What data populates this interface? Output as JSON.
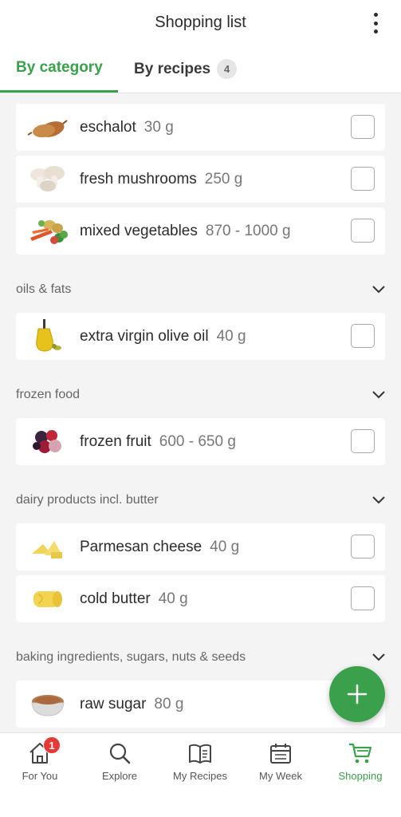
{
  "header": {
    "title": "Shopping list",
    "tabs": [
      {
        "label": "By category",
        "active": true
      },
      {
        "label": "By recipes",
        "badge": "4",
        "active": false
      }
    ]
  },
  "list": {
    "items_top": [
      {
        "name": "eschalot",
        "qty": "30 g",
        "icon": "shallot-image"
      },
      {
        "name": "fresh mushrooms",
        "qty": "250 g",
        "icon": "mushrooms-image"
      },
      {
        "name": "mixed vegetables",
        "qty": "870 - 1000 g",
        "icon": "vegetables-image"
      }
    ],
    "categories": [
      {
        "label": "oils & fats",
        "items": [
          {
            "name": "extra virgin olive oil",
            "qty": "40 g",
            "icon": "olive-oil-image"
          }
        ]
      },
      {
        "label": "frozen food",
        "items": [
          {
            "name": "frozen fruit",
            "qty": "600 - 650 g",
            "icon": "berries-image"
          }
        ]
      },
      {
        "label": "dairy products incl. butter",
        "items": [
          {
            "name": "Parmesan cheese",
            "qty": "40 g",
            "icon": "cheese-image"
          },
          {
            "name": "cold butter",
            "qty": "40 g",
            "icon": "butter-image"
          }
        ]
      },
      {
        "label": "baking ingredients, sugars, nuts & seeds",
        "items": [
          {
            "name": "raw sugar",
            "qty": "80 g",
            "icon": "sugar-bowl-image"
          }
        ]
      }
    ]
  },
  "fab": {
    "icon": "plus-icon"
  },
  "bottom_nav": [
    {
      "label": "For You",
      "icon": "home-icon",
      "badge": "1"
    },
    {
      "label": "Explore",
      "icon": "search-icon"
    },
    {
      "label": "My Recipes",
      "icon": "book-icon"
    },
    {
      "label": "My Week",
      "icon": "calendar-icon"
    },
    {
      "label": "Shopping",
      "icon": "cart-icon",
      "active": true
    }
  ],
  "colors": {
    "accent": "#3aa04b",
    "badge": "#e53935",
    "background": "#f4f4f4"
  }
}
